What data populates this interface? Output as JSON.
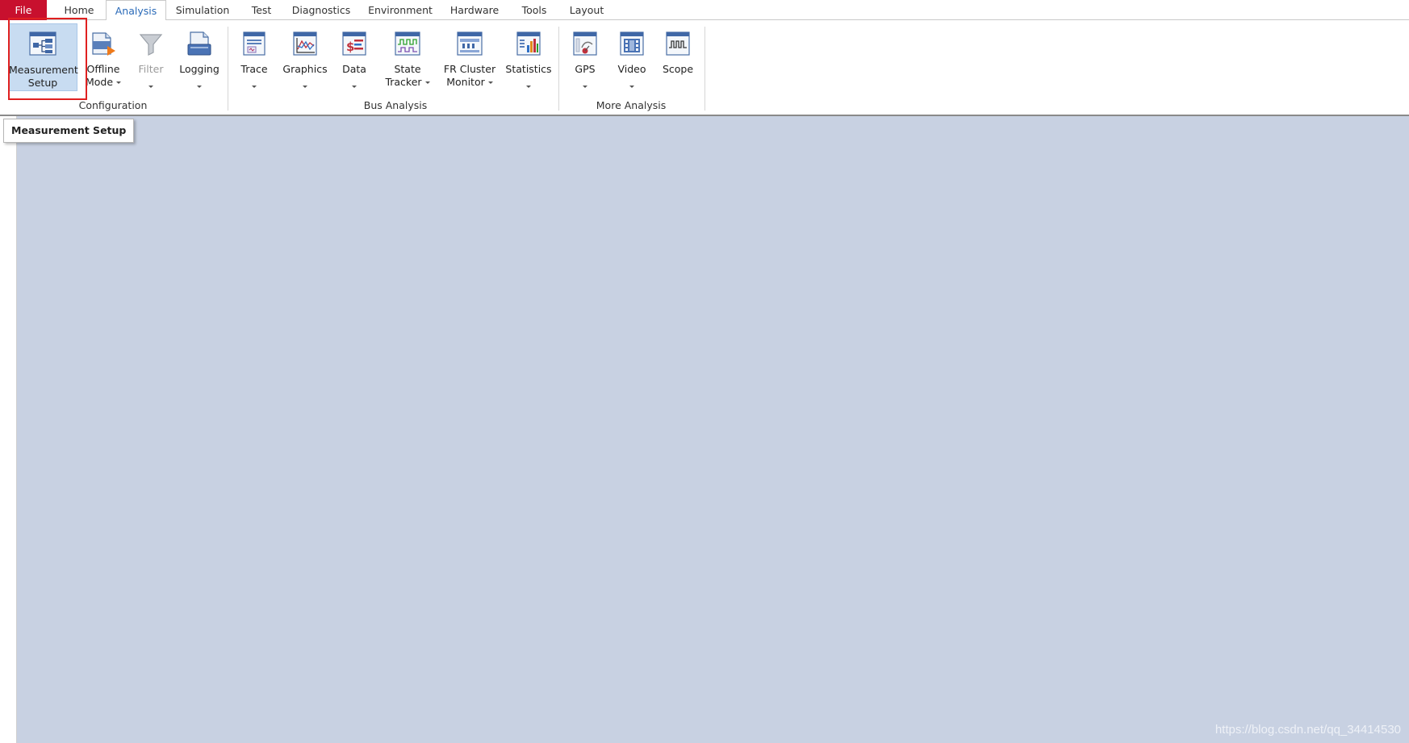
{
  "tabs": [
    {
      "label": "File"
    },
    {
      "label": "Home"
    },
    {
      "label": "Analysis"
    },
    {
      "label": "Simulation"
    },
    {
      "label": "Test"
    },
    {
      "label": "Diagnostics"
    },
    {
      "label": "Environment"
    },
    {
      "label": "Hardware"
    },
    {
      "label": "Tools"
    },
    {
      "label": "Layout"
    }
  ],
  "active_tab": "Analysis",
  "ribbon": {
    "groups": [
      {
        "label": "Configuration"
      },
      {
        "label": "Bus Analysis"
      },
      {
        "label": "More Analysis"
      }
    ],
    "buttons": {
      "measurement_setup": "Measurement\nSetup",
      "offline_mode_1": "Offline",
      "offline_mode_2": "Mode",
      "filter": "Filter",
      "logging": "Logging",
      "trace": "Trace",
      "graphics": "Graphics",
      "data": "Data",
      "state_tracker_1": "State",
      "state_tracker_2": "Tracker",
      "fr_cluster_monitor_1": "FR Cluster",
      "fr_cluster_monitor_2": "Monitor",
      "statistics": "Statistics",
      "gps": "GPS",
      "video": "Video",
      "scope": "Scope"
    }
  },
  "tooltip": "Measurement Setup",
  "watermark": "https://blog.csdn.net/qq_34414530",
  "colors": {
    "file_tab": "#c8102e",
    "active_tab_text": "#2a6ab8",
    "workspace": "#c8d1e2",
    "highlight": "#e02020"
  }
}
